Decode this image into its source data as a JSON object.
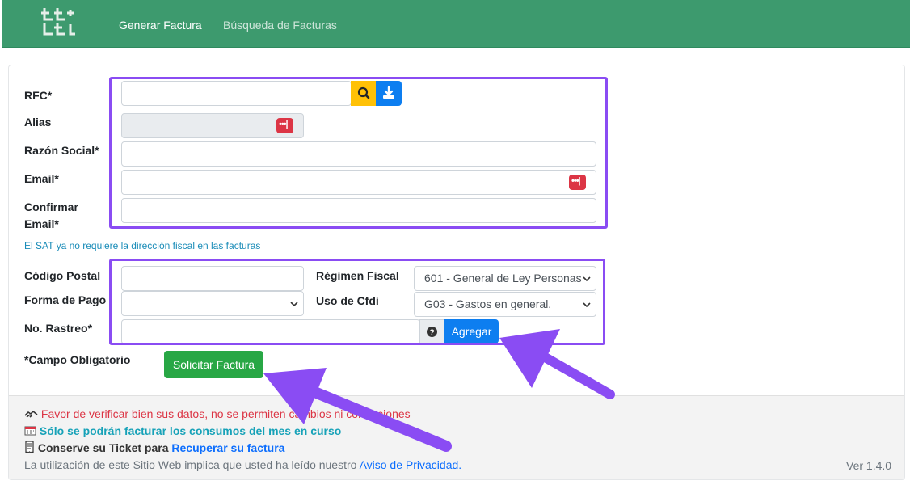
{
  "nav": {
    "link_generar": "Generar Factura",
    "link_busqueda": "Búsqueda de Facturas"
  },
  "form": {
    "rfc_label": "RFC*",
    "alias_label": "Alias",
    "razon_label": "Razón Social*",
    "email_label": "Email*",
    "confirm_label_1": "Confirmar",
    "confirm_label_2": "Email*",
    "note": "El SAT ya no requiere la dirección fiscal en las facturas",
    "cp_label": "Código Postal",
    "forma_pago_label": "Forma de Pago",
    "rastreo_label": "No. Rastreo*",
    "regimen_label": "Régimen Fiscal",
    "regimen_value": "601 - General de Ley Personas",
    "uso_label": "Uso de Cfdi",
    "uso_value": "G03 - Gastos en general.",
    "agregar_label": "Agregar",
    "required_note": "*Campo Obligatorio",
    "solicitar_label": "Solicitar Factura"
  },
  "footer": {
    "warn_text": "Favor de verificar bien sus datos, no se permiten cambios ni correcciones",
    "consumo_text": "Sólo se podrán facturar los consumos del mes en curso",
    "ticket_prefix": "Conserve su Ticket para",
    "ticket_link": "Recuperar su factura",
    "privacy_prefix": "La utilización de este Sitio Web implica que usted ha leído nuestro",
    "privacy_link": "Aviso de Privacidad",
    "privacy_suffix": ".",
    "version": "Ver 1.4.0"
  },
  "colors": {
    "navbar": "#3d9a6e",
    "highlight": "#8a4cf3",
    "search_button": "#ffc107",
    "primary": "#0d7ef0",
    "success": "#28a745",
    "danger": "#dc3545"
  },
  "icons": [
    "logo-icon",
    "search-icon",
    "download-icon",
    "password-manager-icon",
    "chevron-down-icon",
    "question-circle-icon",
    "handshake-icon",
    "calendar-icon",
    "receipt-icon"
  ]
}
